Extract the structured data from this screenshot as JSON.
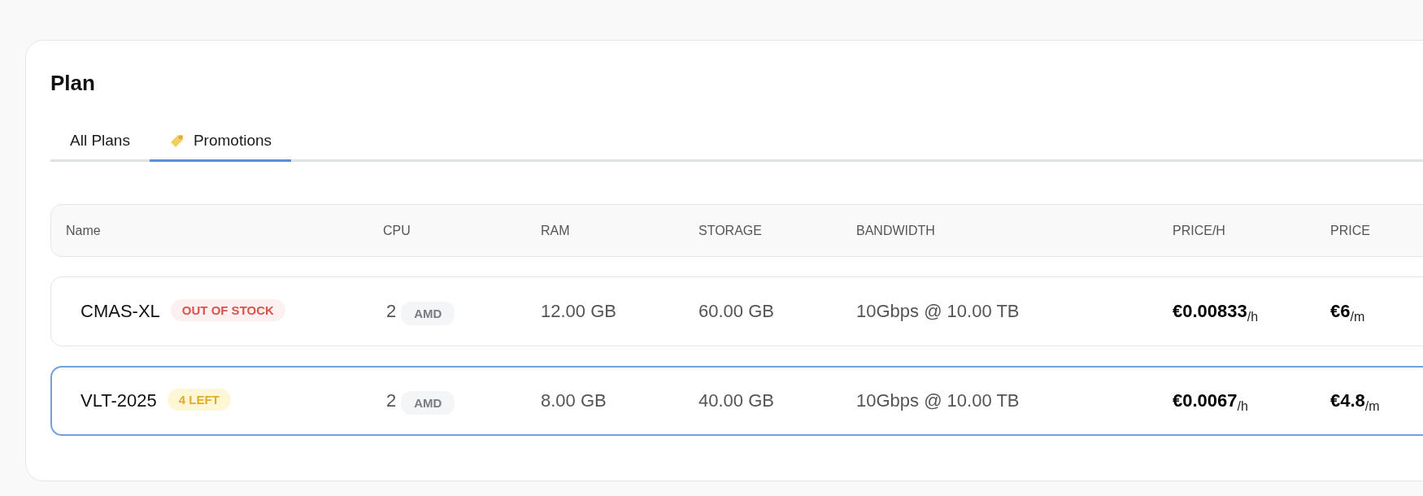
{
  "title": "Plan",
  "tabs": [
    {
      "label": "All Plans",
      "selected": false,
      "icon": false
    },
    {
      "label": "Promotions",
      "selected": true,
      "icon": true
    }
  ],
  "table": {
    "columns": [
      "Name",
      "CPU",
      "RAM",
      "STORAGE",
      "BANDWIDTH",
      "PRICE/H",
      "PRICE"
    ],
    "rows": [
      {
        "name": "CMAS-XL",
        "badge": {
          "kind": "out_of_stock",
          "text": "OUT OF STOCK"
        },
        "cpu": "2",
        "cpu_vendor": "AMD",
        "ram": "12.00 GB",
        "storage": "60.00 GB",
        "bandwidth": "10Gbps @ 10.00 TB",
        "price_h": {
          "amount": "€0.00833",
          "unit": "/h"
        },
        "price": {
          "amount": "€6",
          "unit": "/m"
        },
        "selected": false
      },
      {
        "name": "VLT-2025",
        "badge": {
          "kind": "low_stock",
          "text": "4 LEFT"
        },
        "cpu": "2",
        "cpu_vendor": "AMD",
        "ram": "8.00 GB",
        "storage": "40.00 GB",
        "bandwidth": "10Gbps @ 10.00 TB",
        "price_h": {
          "amount": "€0.0067",
          "unit": "/h"
        },
        "price": {
          "amount": "€4.8",
          "unit": "/m"
        },
        "selected": true
      }
    ]
  }
}
